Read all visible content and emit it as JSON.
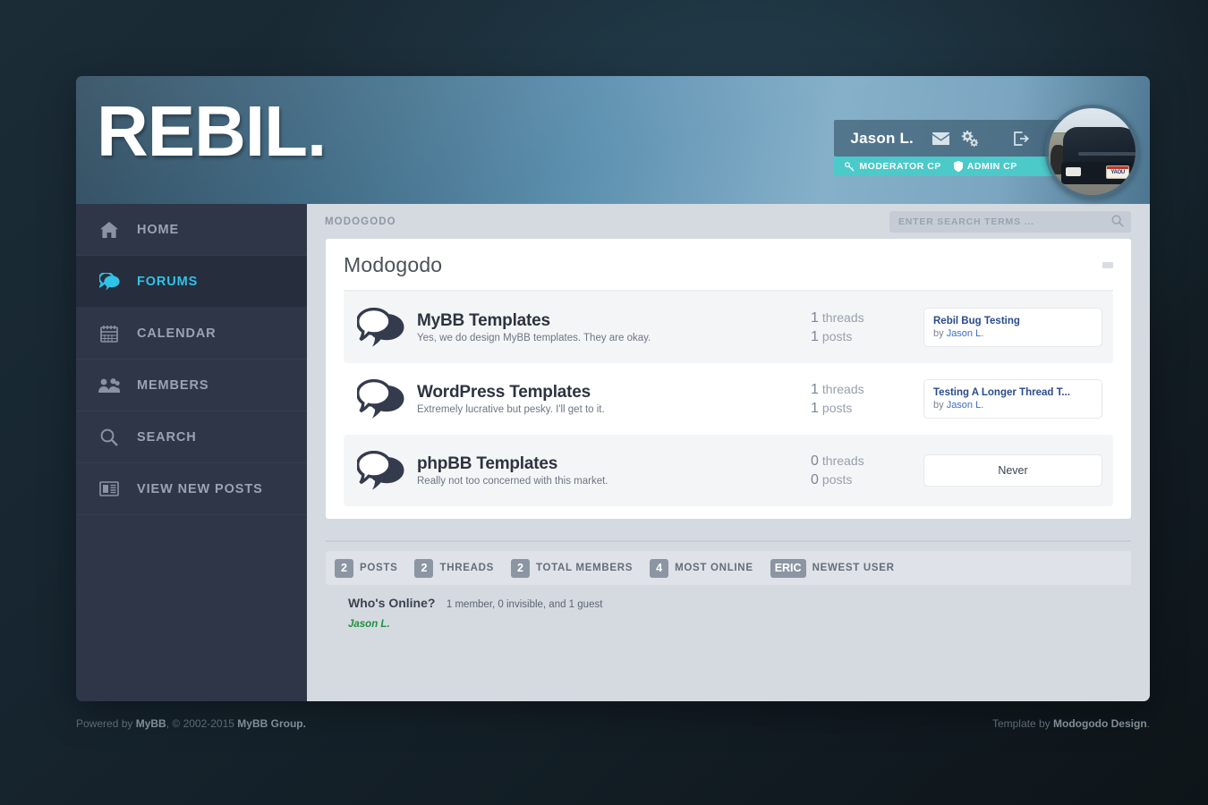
{
  "site": {
    "logo": "REBIL.",
    "breadcrumb": "MODOGODO"
  },
  "user": {
    "name": "Jason L.",
    "icons": [
      "envelope-icon",
      "cogs-icon",
      "logout-icon"
    ],
    "cp_links": [
      {
        "label": "MODERATOR CP",
        "icon": "key-icon"
      },
      {
        "label": "ADMIN CP",
        "icon": "shield-icon"
      }
    ],
    "avatar_alt": "car-avatar",
    "avatar_plate": "YAOU"
  },
  "search": {
    "placeholder": "ENTER SEARCH TERMS ...",
    "value": ""
  },
  "sidebar": {
    "items": [
      {
        "label": "HOME",
        "icon": "home-icon",
        "active": false
      },
      {
        "label": "FORUMS",
        "icon": "speech-bubbles-icon",
        "active": true
      },
      {
        "label": "CALENDAR",
        "icon": "calendar-icon",
        "active": false
      },
      {
        "label": "MEMBERS",
        "icon": "users-icon",
        "active": false
      },
      {
        "label": "SEARCH",
        "icon": "magnifier-icon",
        "active": false
      },
      {
        "label": "VIEW NEW POSTS",
        "icon": "newspaper-icon",
        "active": false
      }
    ]
  },
  "category": {
    "title": "Modogodo",
    "forums": [
      {
        "name": "MyBB Templates",
        "description": "Yes, we do design MyBB templates. They are okay.",
        "threads": "1",
        "threads_label": "threads",
        "posts": "1",
        "posts_label": "posts",
        "last_post": {
          "title": "Rebil Bug Testing",
          "by_prefix": "by",
          "author": "Jason L.",
          "never": false
        }
      },
      {
        "name": "WordPress Templates",
        "description": "Extremely lucrative but pesky. I'll get to it.",
        "threads": "1",
        "threads_label": "threads",
        "posts": "1",
        "posts_label": "posts",
        "last_post": {
          "title": "Testing A Longer Thread T...",
          "by_prefix": "by",
          "author": "Jason L.",
          "never": false
        }
      },
      {
        "name": "phpBB Templates",
        "description": "Really not too concerned with this market.",
        "threads": "0",
        "threads_label": "threads",
        "posts": "0",
        "posts_label": "posts",
        "last_post": {
          "title": "Never",
          "by_prefix": "",
          "author": "",
          "never": true
        }
      }
    ]
  },
  "stats": [
    {
      "value": "2",
      "label": "POSTS"
    },
    {
      "value": "2",
      "label": "THREADS"
    },
    {
      "value": "2",
      "label": "TOTAL MEMBERS"
    },
    {
      "value": "4",
      "label": "MOST ONLINE"
    },
    {
      "value": "ERIC",
      "label": "NEWEST USER"
    }
  ],
  "whos_online": {
    "heading": "Who's Online?",
    "summary": "1 member, 0 invisible, and 1 guest",
    "members": [
      "Jason L."
    ]
  },
  "footer": {
    "left_prefix": "Powered by ",
    "left_brand1": "MyBB",
    "left_mid": ", © 2002-2015 ",
    "left_brand2": "MyBB Group.",
    "right_prefix": "Template by ",
    "right_brand": "Modogodo Design",
    "right_suffix": "."
  },
  "colors": {
    "accent": "#2fc3e8",
    "cp_bar": "#4cc9c9",
    "sidebar": "#2e3648",
    "content_bg": "#d5dae1",
    "online_user": "#1f8f3c"
  }
}
